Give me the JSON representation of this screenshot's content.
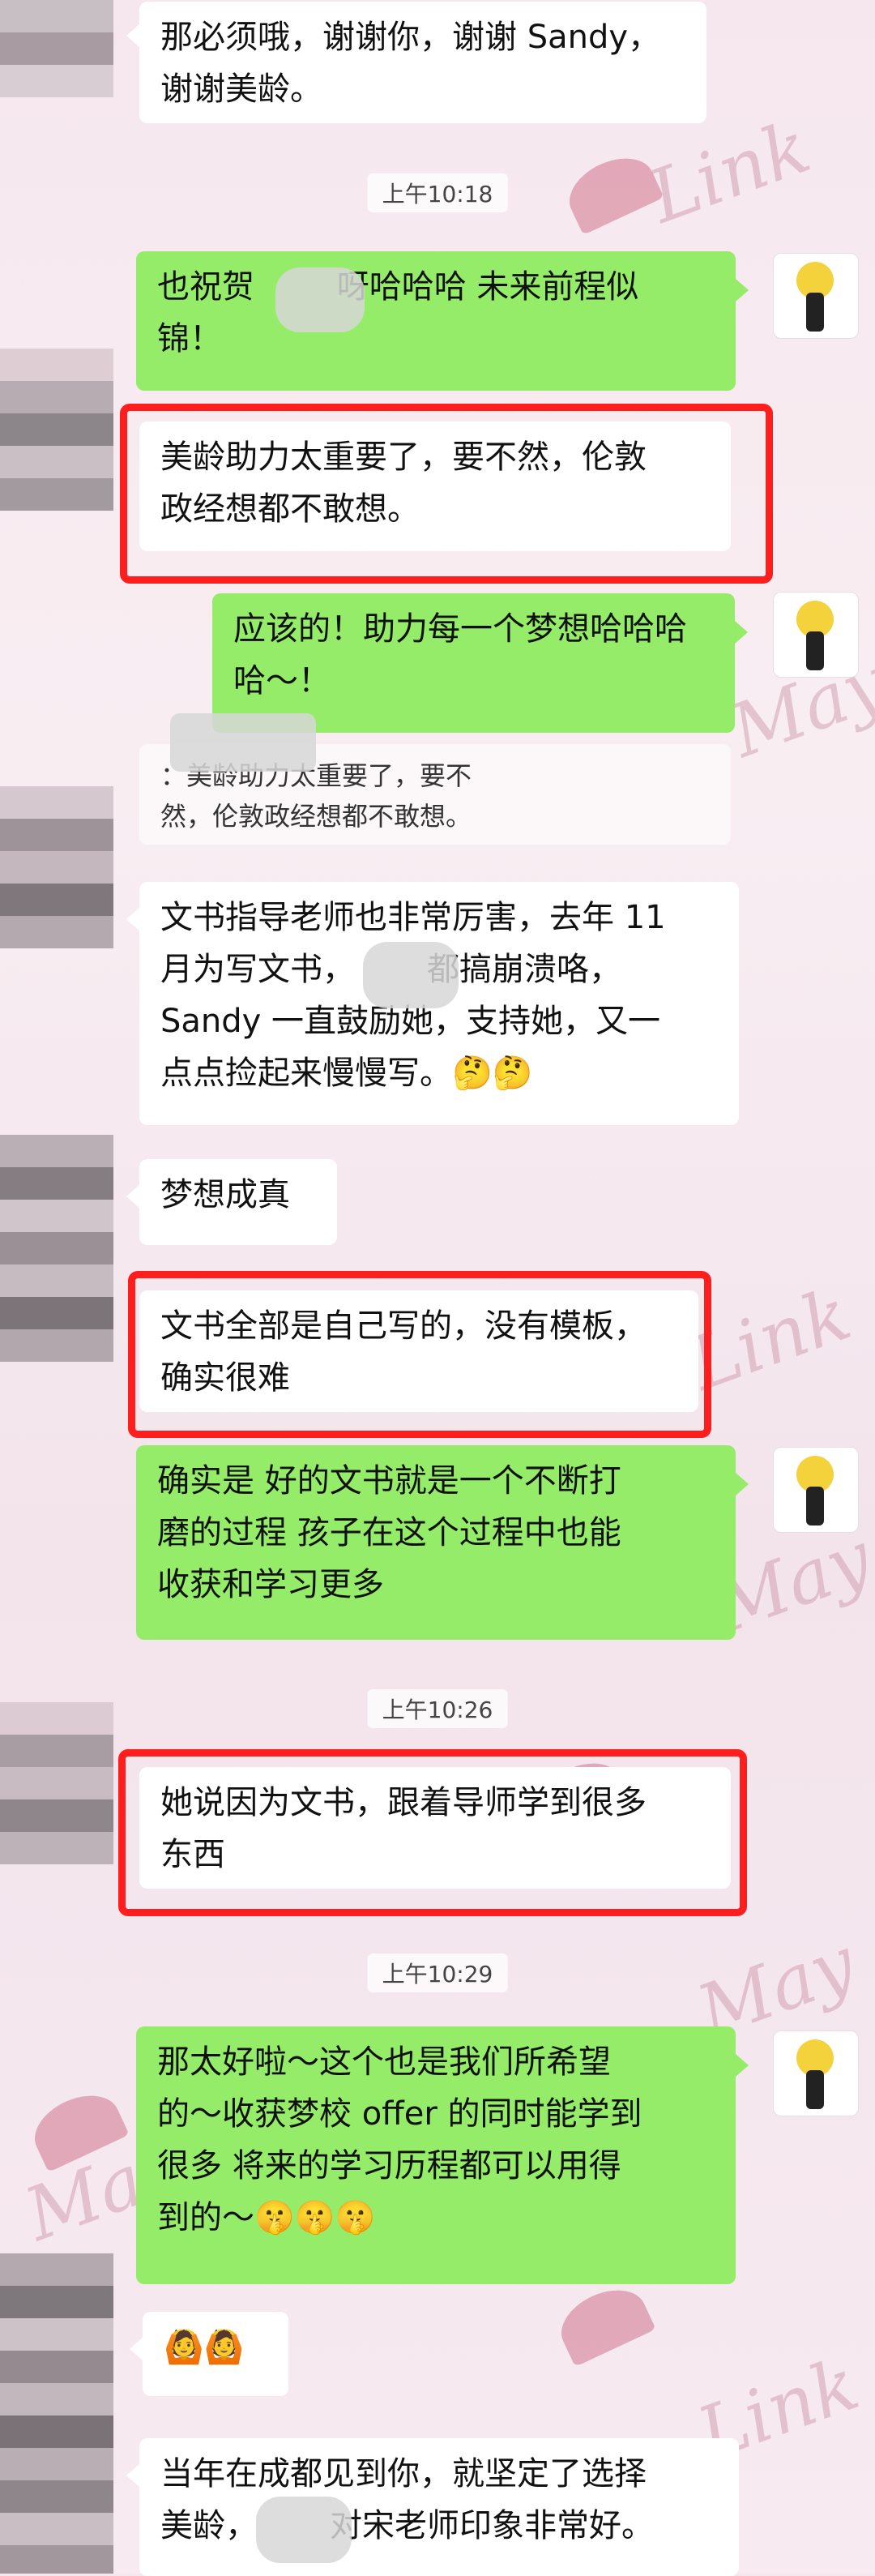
{
  "messages": {
    "m1": "那必须哦，谢谢你，谢谢 Sandy，\n谢谢美龄。",
    "m2": "也祝贺        呀哈哈哈 未来前程似\n锦！",
    "m3": "美龄助力太重要了，要不然，伦敦\n政经想都不敢想。",
    "m4": "应该的！助力每一个梦想哈哈哈\n哈～！",
    "m5_quote": "：美龄助力太重要了，要不\n然，伦敦政经想都不敢想。",
    "m6": "文书指导老师也非常厉害，去年 11\n月为写文书，       都搞崩溃咯，\nSandy 一直鼓励她，支持她，又一\n点点捡起来慢慢写。🤔🤔",
    "m7": "梦想成真",
    "m8": "文书全部是自己写的，没有模板，\n确实很难",
    "m9": "确实是 好的文书就是一个不断打\n磨的过程 孩子在这个过程中也能\n收获和学习更多",
    "m10": "她说因为文书，跟着导师学到很多\n东西",
    "m11": "那太好啦～这个也是我们所希望\n的～收获梦校 offer 的同时能学到\n很多 将来的学习历程都可以用得\n到的～🤫🤫🤫",
    "m12": "🙆🙆",
    "m13": "当年在成都见到你，就坚定了选择\n美龄，       对宋老师印象非常好。"
  },
  "times": {
    "t1": "上午10:18",
    "t2": "上午10:26",
    "t3": "上午10:29"
  },
  "colors": {
    "green_bubble": "#95ec69",
    "highlight": "#ff1e1e"
  }
}
